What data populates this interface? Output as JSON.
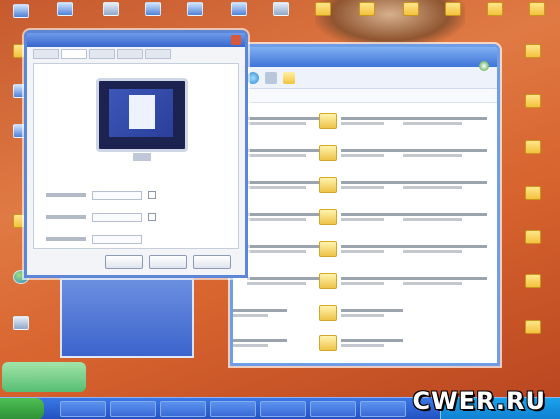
{
  "desktop": {
    "watermark": "CWER.RU",
    "icons": [
      {
        "name": "desktop-icon-1",
        "kind": "folder"
      },
      {
        "name": "desktop-icon-2",
        "kind": "app"
      },
      {
        "name": "desktop-icon-3",
        "kind": "app"
      },
      {
        "name": "desktop-icon-4",
        "kind": "app"
      },
      {
        "name": "desktop-icon-5",
        "kind": "globe"
      },
      {
        "name": "desktop-icon-6",
        "kind": "pc"
      }
    ]
  },
  "explorer": {
    "toolbar_icons": [
      "back-icon",
      "up-icon",
      "folder-icon"
    ],
    "files": [
      {
        "icon": "folder-icon"
      },
      {
        "icon": "folder-icon"
      },
      {
        "icon": "folder-icon"
      },
      {
        "icon": "folder-icon"
      },
      {
        "icon": "folder-icon"
      },
      {
        "icon": "folder-icon"
      },
      {
        "icon": "folder-icon"
      },
      {
        "icon": "folder-icon"
      },
      {
        "icon": "folder-icon"
      },
      {
        "icon": "folder-icon"
      },
      {
        "icon": "folder-icon"
      },
      {
        "icon": "folder-icon"
      }
    ]
  },
  "dialog": {
    "tabs": 5,
    "buttons": [
      "ok-button",
      "cancel-button",
      "apply-button"
    ]
  },
  "colors": {
    "desktop_bg": "#d8642f",
    "window_border": "#6f9ee8",
    "taskbar": "#2251c2",
    "start_button": "#2c8f34"
  }
}
